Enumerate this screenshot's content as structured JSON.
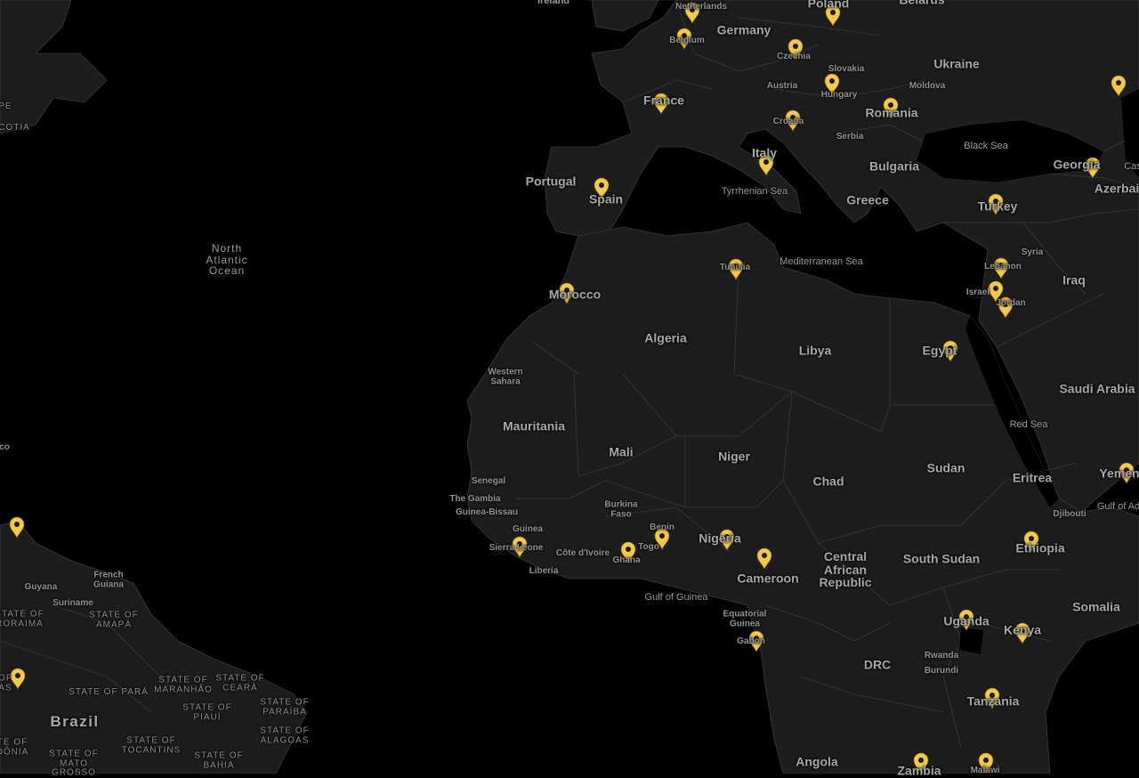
{
  "labels": [
    {
      "id": "ireland",
      "text": "Ireland",
      "cls": "c2"
    },
    {
      "id": "netherlands",
      "text": "Netherlands",
      "cls": "c3"
    },
    {
      "id": "poland",
      "text": "Poland",
      "cls": "c1"
    },
    {
      "id": "belarus",
      "text": "Belarus",
      "cls": "c1"
    },
    {
      "id": "germany",
      "text": "Germany",
      "cls": "c1"
    },
    {
      "id": "belgium",
      "text": "Belgium",
      "cls": "c3"
    },
    {
      "id": "czechia",
      "text": "Czechia",
      "cls": "c3"
    },
    {
      "id": "ukraine",
      "text": "Ukraine",
      "cls": "c1"
    },
    {
      "id": "slovakia",
      "text": "Slovakia",
      "cls": "c3"
    },
    {
      "id": "austria",
      "text": "Austria",
      "cls": "c3"
    },
    {
      "id": "moldova",
      "text": "Moldova",
      "cls": "c3"
    },
    {
      "id": "hungary",
      "text": "Hungary",
      "cls": "c3"
    },
    {
      "id": "france",
      "text": "France",
      "cls": "c1"
    },
    {
      "id": "romania",
      "text": "Romania",
      "cls": "c1"
    },
    {
      "id": "croatia",
      "text": "Croatia",
      "cls": "c3"
    },
    {
      "id": "serbia",
      "text": "Serbia",
      "cls": "c3"
    },
    {
      "id": "black-sea",
      "text": "Black Sea",
      "cls": "sea"
    },
    {
      "id": "italy",
      "text": "Italy",
      "cls": "c1"
    },
    {
      "id": "bulgaria",
      "text": "Bulgaria",
      "cls": "c1"
    },
    {
      "id": "georgia",
      "text": "Georgia",
      "cls": "c1"
    },
    {
      "id": "caspian",
      "text": "Cas",
      "cls": "sea"
    },
    {
      "id": "portugal",
      "text": "Portugal",
      "cls": "c1"
    },
    {
      "id": "spain",
      "text": "Spain",
      "cls": "c1"
    },
    {
      "id": "azerbaijan",
      "text": "Azerbai",
      "cls": "c1"
    },
    {
      "id": "tyrrhenian",
      "text": "Tyrrhenian Sea",
      "cls": "sea"
    },
    {
      "id": "greece",
      "text": "Greece",
      "cls": "c1"
    },
    {
      "id": "turkey",
      "text": "Turkey",
      "cls": "c1"
    },
    {
      "id": "north-atlantic",
      "text": "North\nAtlantic\nOcean",
      "cls": "ocean"
    },
    {
      "id": "syria",
      "text": "Syria",
      "cls": "c3"
    },
    {
      "id": "tunisia",
      "text": "Tunisia",
      "cls": "c3"
    },
    {
      "id": "mediterranean",
      "text": "Mediterranean Sea",
      "cls": "sea"
    },
    {
      "id": "lebanon",
      "text": "Lebanon",
      "cls": "c3"
    },
    {
      "id": "iraq",
      "text": "Iraq",
      "cls": "c1"
    },
    {
      "id": "morocco",
      "text": "Morocco",
      "cls": "c1"
    },
    {
      "id": "israel",
      "text": "Israel",
      "cls": "c3"
    },
    {
      "id": "jordan",
      "text": "Jordan",
      "cls": "c3"
    },
    {
      "id": "algeria",
      "text": "Algeria",
      "cls": "c1"
    },
    {
      "id": "libya",
      "text": "Libya",
      "cls": "c1"
    },
    {
      "id": "egypt",
      "text": "Egypt",
      "cls": "c1"
    },
    {
      "id": "western-sahara",
      "text": "Western\nSahara",
      "cls": "c3"
    },
    {
      "id": "saudi-arabia",
      "text": "Saudi Arabia",
      "cls": "c1"
    },
    {
      "id": "red-sea",
      "text": "Red Sea",
      "cls": "sea"
    },
    {
      "id": "mauritania",
      "text": "Mauritania",
      "cls": "c1"
    },
    {
      "id": "mali",
      "text": "Mali",
      "cls": "c1"
    },
    {
      "id": "niger",
      "text": "Niger",
      "cls": "c1"
    },
    {
      "id": "sudan",
      "text": "Sudan",
      "cls": "c1"
    },
    {
      "id": "yemen",
      "text": "Yemen",
      "cls": "c1"
    },
    {
      "id": "eritrea",
      "text": "Eritrea",
      "cls": "c1"
    },
    {
      "id": "chad",
      "text": "Chad",
      "cls": "c1"
    },
    {
      "id": "senegal",
      "text": "Senegal",
      "cls": "c3"
    },
    {
      "id": "gambia",
      "text": "The Gambia",
      "cls": "c3"
    },
    {
      "id": "gulf-aden",
      "text": "Gulf of Ad",
      "cls": "sea"
    },
    {
      "id": "guinea-bissau",
      "text": "Guinea-Bissau",
      "cls": "c3"
    },
    {
      "id": "burkina-faso",
      "text": "Burkina\nFaso",
      "cls": "c3"
    },
    {
      "id": "djibouti",
      "text": "Djibouti",
      "cls": "c3"
    },
    {
      "id": "guinea",
      "text": "Guinea",
      "cls": "c3"
    },
    {
      "id": "benin",
      "text": "Benin",
      "cls": "c3"
    },
    {
      "id": "nigeria",
      "text": "Nigeria",
      "cls": "c1"
    },
    {
      "id": "sierra-leone",
      "text": "Sierra Leone",
      "cls": "c3"
    },
    {
      "id": "cote-divoire",
      "text": "Côte d'Ivoire",
      "cls": "c3"
    },
    {
      "id": "togo",
      "text": "Togo",
      "cls": "c3"
    },
    {
      "id": "ethiopia",
      "text": "Ethiopia",
      "cls": "c1"
    },
    {
      "id": "central-african-republic",
      "text": "Central\nAfrican\nRepublic",
      "cls": "c1"
    },
    {
      "id": "south-sudan",
      "text": "South Sudan",
      "cls": "c1"
    },
    {
      "id": "ghana",
      "text": "Ghana",
      "cls": "c3"
    },
    {
      "id": "liberia",
      "text": "Liberia",
      "cls": "c3"
    },
    {
      "id": "cameroon",
      "text": "Cameroon",
      "cls": "c1"
    },
    {
      "id": "gulf-guinea",
      "text": "Gulf of Guinea",
      "cls": "sea"
    },
    {
      "id": "somalia",
      "text": "Somalia",
      "cls": "c1"
    },
    {
      "id": "equatorial-guinea",
      "text": "Equatorial\nGuinea",
      "cls": "c3"
    },
    {
      "id": "uganda",
      "text": "Uganda",
      "cls": "c1"
    },
    {
      "id": "kenya",
      "text": "Kenya",
      "cls": "c1"
    },
    {
      "id": "gabon",
      "text": "Gabon",
      "cls": "c3"
    },
    {
      "id": "drc",
      "text": "DRC",
      "cls": "c1"
    },
    {
      "id": "rwanda",
      "text": "Rwanda",
      "cls": "c3"
    },
    {
      "id": "burundi",
      "text": "Burundi",
      "cls": "c3"
    },
    {
      "id": "tanzania",
      "text": "Tanzania",
      "cls": "c1"
    },
    {
      "id": "angola",
      "text": "Angola",
      "cls": "c1"
    },
    {
      "id": "zambia",
      "text": "Zambia",
      "cls": "c1"
    },
    {
      "id": "malawi",
      "text": "Malawi",
      "cls": "c3"
    },
    {
      "id": "nova-scotia-1",
      "text": "PE",
      "cls": "state"
    },
    {
      "id": "nova-scotia-2",
      "text": "COTIA",
      "cls": "state"
    },
    {
      "id": "mexico-edge",
      "text": "co",
      "cls": "c3"
    },
    {
      "id": "french-guiana",
      "text": "French\nGuiana",
      "cls": "c3"
    },
    {
      "id": "guyana",
      "text": "Guyana",
      "cls": "c3"
    },
    {
      "id": "suriname",
      "text": "Suriname",
      "cls": "c3"
    },
    {
      "id": "roraima",
      "text": "STATE OF\nRORAIMA",
      "cls": "state"
    },
    {
      "id": "amapa",
      "text": "STATE OF\nAMAPÁ",
      "cls": "state"
    },
    {
      "id": "amazonas",
      "text": "OF\nAS",
      "cls": "state"
    },
    {
      "id": "maranhao",
      "text": "STATE OF\nMARANHÃO",
      "cls": "state"
    },
    {
      "id": "ceara",
      "text": "STATE OF\nCEARÁ",
      "cls": "state"
    },
    {
      "id": "para",
      "text": "STATE OF PARÁ",
      "cls": "state"
    },
    {
      "id": "piaui",
      "text": "STATE OF\nPIAUÍ",
      "cls": "state"
    },
    {
      "id": "paraiba",
      "text": "STATE OF\nPARAÍBA",
      "cls": "state"
    },
    {
      "id": "brazil",
      "text": "Brazil",
      "cls": "brazil"
    },
    {
      "id": "alagoas",
      "text": "STATE OF\nALAGOAS",
      "cls": "state"
    },
    {
      "id": "tocantins",
      "text": "STATE OF\nTOCANTINS",
      "cls": "state"
    },
    {
      "id": "rondonia",
      "text": "TE OF\nDÔNIA",
      "cls": "state"
    },
    {
      "id": "bahia",
      "text": "STATE OF\nBAHIA",
      "cls": "state"
    },
    {
      "id": "mato-grosso",
      "text": "STATE OF\nMATO\nGROSSO",
      "cls": "state"
    }
  ],
  "pin_color": "#f2c94c",
  "pin_count": 34,
  "land_color": "#1d1d1d",
  "water_color": "#000000",
  "border_color": "#3a3a3a"
}
